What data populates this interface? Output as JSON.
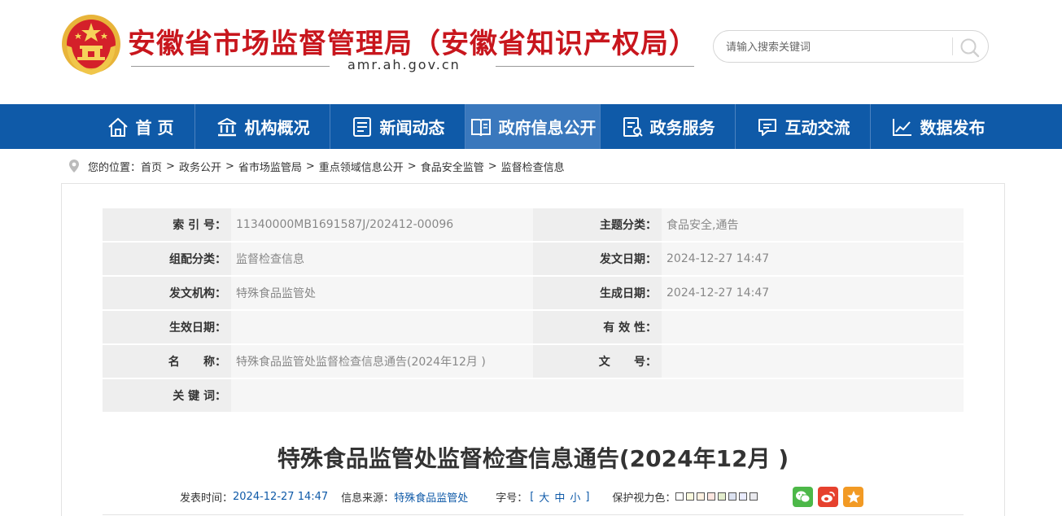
{
  "header": {
    "site_title": "安徽省市场监督管理局（安徽省知识产权局）",
    "domain": "amr.ah.gov.cn",
    "search": {
      "placeholder": "请输入搜索关键词"
    }
  },
  "nav": {
    "items": [
      {
        "label": "首 页",
        "icon": "home-icon"
      },
      {
        "label": "机构概况",
        "icon": "institution-icon"
      },
      {
        "label": "新闻动态",
        "icon": "news-icon"
      },
      {
        "label": "政府信息公开",
        "icon": "book-icon",
        "active": true
      },
      {
        "label": "政务服务",
        "icon": "document-icon"
      },
      {
        "label": "互动交流",
        "icon": "chat-icon"
      },
      {
        "label": "数据发布",
        "icon": "chart-icon"
      }
    ]
  },
  "breadcrumb": {
    "prefix": "您的位置：",
    "items": [
      "首页",
      "政务公开",
      "省市场监管局",
      "重点领域信息公开",
      "食品安全监管",
      "监督检查信息"
    ]
  },
  "meta": {
    "rows": [
      [
        {
          "label": "索 引 号：",
          "value": "11340000MB1691587J/202412-00096"
        },
        {
          "label": "主题分类：",
          "value": "食品安全,通告"
        }
      ],
      [
        {
          "label": "组配分类：",
          "value": "监督检查信息"
        },
        {
          "label": "发文日期：",
          "value": "2024-12-27 14:47"
        }
      ],
      [
        {
          "label": "发文机构：",
          "value": "特殊食品监管处"
        },
        {
          "label": "生成日期：",
          "value": "2024-12-27 14:47"
        }
      ],
      [
        {
          "label": "生效日期：",
          "value": ""
        },
        {
          "label": "有 效 性：",
          "value": ""
        }
      ],
      [
        {
          "label": "名      称：",
          "value": "特殊食品监管处监督检查信息通告(2024年12月 )"
        },
        {
          "label": "文      号：",
          "value": ""
        }
      ],
      [
        {
          "label": "关 键 词：",
          "value": ""
        }
      ]
    ]
  },
  "article": {
    "title": "特殊食品监管处监督检查信息通告(2024年12月 )",
    "publish_label": "发表时间：",
    "publish_time": "2024-12-27 14:47",
    "source_label": "信息来源：",
    "source": "特殊食品监管处",
    "font_size_label": "字号：",
    "font_open": "[",
    "font_large": "大",
    "font_medium": "中",
    "font_small": "小",
    "font_close": "]",
    "eye_care_label": "保护视力色：",
    "eye_care_colors": [
      "#ffffff",
      "#faf9de",
      "#fff2e2",
      "#fde6e0",
      "#e3edcd",
      "#dce2f1",
      "#e9ebfe",
      "#eaeaef"
    ]
  },
  "colors": {
    "brand_red": "#c8161d",
    "nav_blue": "#0f5aa8",
    "nav_active": "#3a78bd",
    "wechat": "#4cb848",
    "weibo": "#e6412e",
    "favorite": "#f29a24"
  }
}
